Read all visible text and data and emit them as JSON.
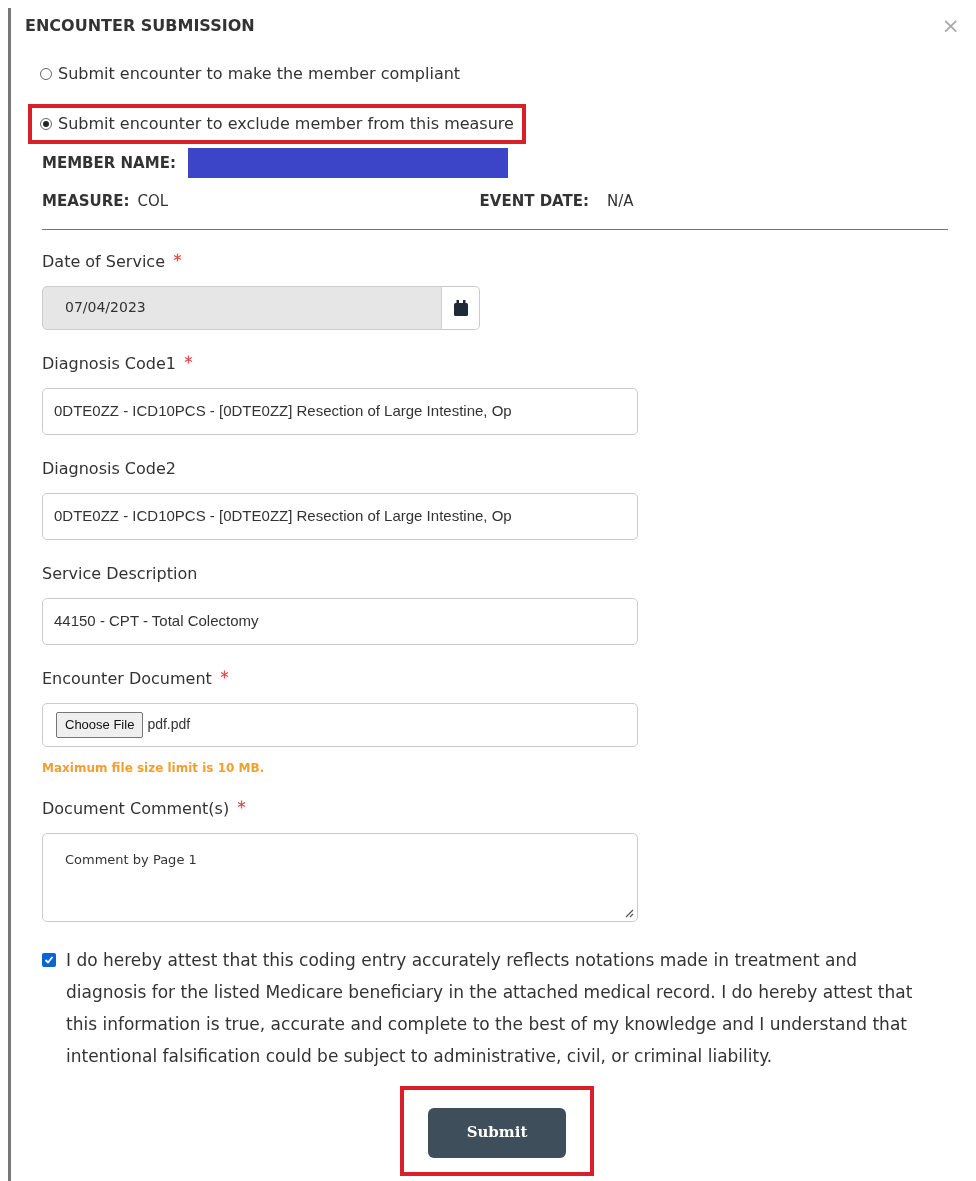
{
  "dialog": {
    "title": "ENCOUNTER SUBMISSION",
    "close": "×"
  },
  "options": [
    {
      "label": "Submit encounter to make the member compliant",
      "selected": false,
      "highlighted": false
    },
    {
      "label": "Submit encounter to exclude member from this measure",
      "selected": true,
      "highlighted": true
    }
  ],
  "member": {
    "name_label": "MEMBER NAME:",
    "name_redacted": true,
    "measure_label": "MEASURE:",
    "measure": "COL",
    "event_date_label": "EVENT DATE:",
    "event_date": "N/A"
  },
  "fields": [
    {
      "kind": "date",
      "label": "Date of Service",
      "required": true,
      "value": "07/04/2023"
    },
    {
      "kind": "text",
      "label": "Diagnosis Code1",
      "required": true,
      "value": "0DTE0ZZ -  ICD10PCS  - [0DTE0ZZ] Resection of Large Intestine, Op"
    },
    {
      "kind": "text",
      "label": "Diagnosis Code2",
      "required": false,
      "value": "0DTE0ZZ -  ICD10PCS  - [0DTE0ZZ] Resection of Large Intestine, Op"
    },
    {
      "kind": "text",
      "label": "Service Description",
      "required": false,
      "value": "44150 -  CPT  - Total Colectomy"
    },
    {
      "kind": "file",
      "label": "Encounter Document",
      "required": true,
      "button": "Choose File",
      "value": "pdf.pdf",
      "hint": "Maximum file size limit is 10 MB."
    },
    {
      "kind": "textarea",
      "label": "Document Comment(s)",
      "required": true,
      "value": "Comment by Page 1"
    }
  ],
  "attestation": {
    "checked": true,
    "text": "I do hereby attest that this coding entry accurately reflects notations made in treatment and diagnosis for the listed Medicare beneficiary in the attached medical record. I do hereby attest that this information is true, accurate and complete to the best of my knowledge and I understand that intentional falsification could be subject to administrative, civil, or criminal liability."
  },
  "submit": {
    "label": "Submit",
    "highlighted": true
  }
}
